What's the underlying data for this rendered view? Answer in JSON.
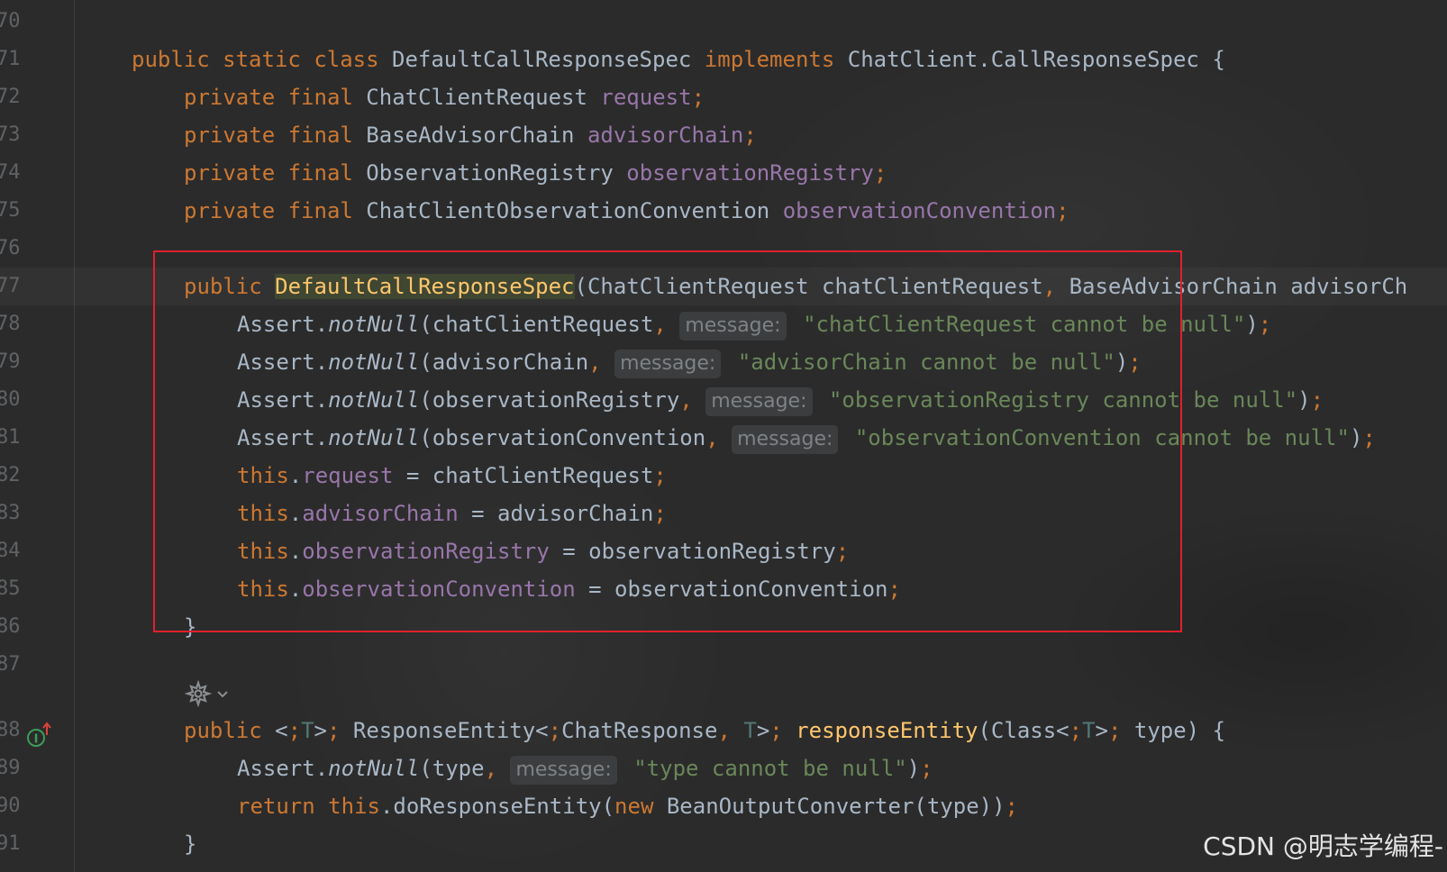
{
  "editor": {
    "lines": [
      {
        "num": "70",
        "code": ""
      },
      {
        "num": "71",
        "code": "public static class DefaultCallResponseSpec implements ChatClient.CallResponseSpec {"
      },
      {
        "num": "72",
        "code": "private final ChatClientRequest request;"
      },
      {
        "num": "73",
        "code": "private final BaseAdvisorChain advisorChain;"
      },
      {
        "num": "74",
        "code": "private final ObservationRegistry observationRegistry;"
      },
      {
        "num": "75",
        "code": "private final ChatClientObservationConvention observationConvention;"
      },
      {
        "num": "76",
        "code": ""
      },
      {
        "num": "77",
        "code": "public DefaultCallResponseSpec(ChatClientRequest chatClientRequest, BaseAdvisorChain advisorCh"
      },
      {
        "num": "78",
        "code": "Assert.notNull(chatClientRequest, message: \"chatClientRequest cannot be null\");"
      },
      {
        "num": "79",
        "code": "Assert.notNull(advisorChain, message: \"advisorChain cannot be null\");"
      },
      {
        "num": "80",
        "code": "Assert.notNull(observationRegistry, message: \"observationRegistry cannot be null\");"
      },
      {
        "num": "81",
        "code": "Assert.notNull(observationConvention, message: \"observationConvention cannot be null\");"
      },
      {
        "num": "82",
        "code": "this.request = chatClientRequest;"
      },
      {
        "num": "83",
        "code": "this.advisorChain = advisorChain;"
      },
      {
        "num": "84",
        "code": "this.observationRegistry = observationRegistry;"
      },
      {
        "num": "85",
        "code": "this.observationConvention = observationConvention;"
      },
      {
        "num": "86",
        "code": "}"
      },
      {
        "num": "87",
        "code": ""
      },
      {
        "num": "88",
        "code": "public <T> ResponseEntity<ChatResponse, T> responseEntity(Class<T> type) {"
      },
      {
        "num": "89",
        "code": "Assert.notNull(type, message: \"type cannot be null\");"
      },
      {
        "num": "90",
        "code": "return this.doResponseEntity(new BeanOutputConverter(type));"
      },
      {
        "num": "91",
        "code": "}"
      }
    ],
    "current_line": "77",
    "inlay_hint_label": "message:"
  },
  "watermark": "CSDN @明志学编程-",
  "colors": {
    "background": "#2b2b2b",
    "keyword": "#cc7832",
    "field": "#9876aa",
    "method": "#ffc66d",
    "string": "#6a8759",
    "default_text": "#a9b7c6",
    "highlight_border": "#e0202c"
  }
}
